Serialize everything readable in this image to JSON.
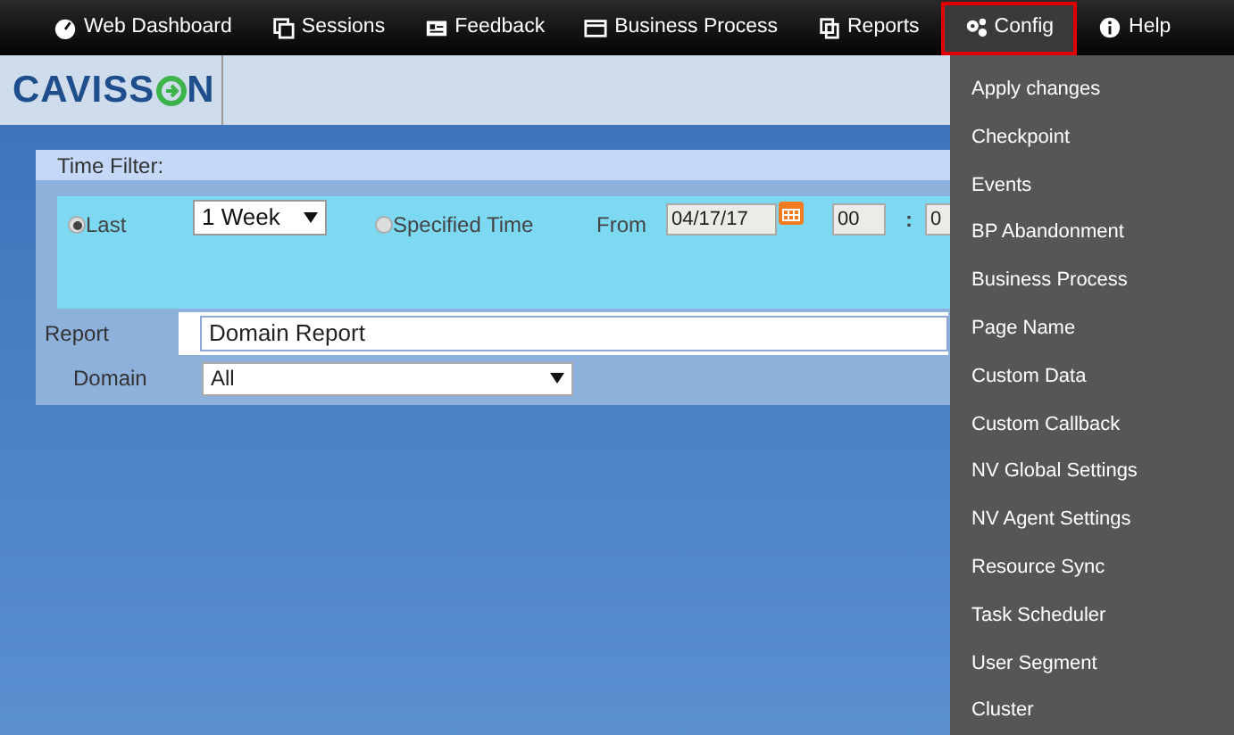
{
  "nav": [
    {
      "label": "Web Dashboard",
      "selected": false
    },
    {
      "label": "Sessions",
      "selected": false
    },
    {
      "label": "Feedback",
      "selected": false
    },
    {
      "label": "Business Process",
      "selected": false
    },
    {
      "label": "Reports",
      "selected": false
    },
    {
      "label": "Config",
      "selected": true
    },
    {
      "label": "Help",
      "selected": false
    }
  ],
  "logo": {
    "text_left": "CAVISS",
    "text_right": "N"
  },
  "time_filter": {
    "title": "Time Filter:",
    "last": {
      "label": "Last",
      "selected": true,
      "value": "1 Week"
    },
    "specified": {
      "label": "Specified Time",
      "selected": false
    },
    "from_label": "From",
    "from_date": "04/17/17",
    "hour": "00",
    "colon": ":",
    "minute": "0"
  },
  "report": {
    "label": "Report",
    "value": "Domain Report"
  },
  "domain": {
    "label": "Domain",
    "value": "All"
  },
  "config_menu": [
    "Apply changes",
    "Checkpoint",
    "Events",
    "BP Abandonment",
    "Business Process",
    "Page Name",
    "Custom Data",
    "Custom Callback",
    "NV Global Settings",
    "NV Agent Settings",
    "Resource Sync",
    "Task Scheduler",
    "User Segment",
    "Cluster"
  ]
}
